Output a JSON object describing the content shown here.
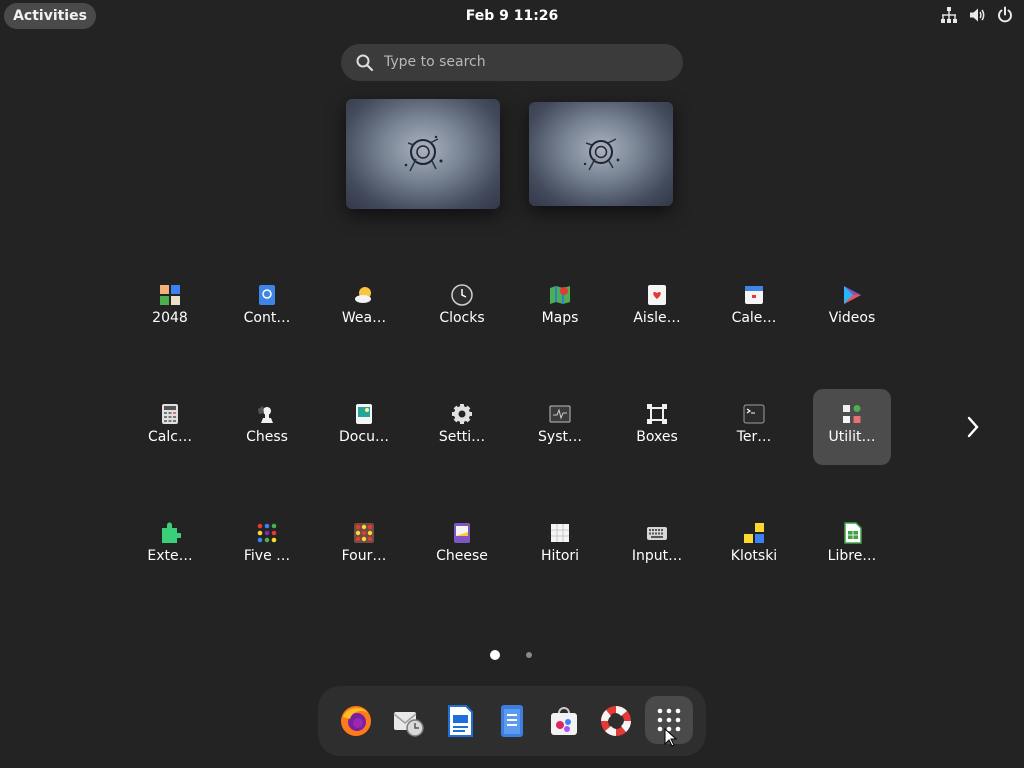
{
  "topbar": {
    "activities_label": "Activities",
    "clock": "Feb 9  11:26",
    "tray_icons": [
      "network-icon",
      "volume-icon",
      "power-icon"
    ]
  },
  "search": {
    "placeholder": "Type to search"
  },
  "workspaces": [
    {
      "name": "workspace-1"
    },
    {
      "name": "workspace-2"
    }
  ],
  "app_grid": {
    "rows": [
      [
        {
          "label": "2048",
          "icon": "2048-icon"
        },
        {
          "label": "Cont…",
          "icon": "contacts-icon"
        },
        {
          "label": "Wea…",
          "icon": "weather-icon"
        },
        {
          "label": "Clocks",
          "icon": "clocks-icon"
        },
        {
          "label": "Maps",
          "icon": "maps-icon"
        },
        {
          "label": "Aisle…",
          "icon": "aisleriot-icon"
        },
        {
          "label": "Cale…",
          "icon": "calendar-icon"
        },
        {
          "label": "Videos",
          "icon": "videos-icon"
        }
      ],
      [
        {
          "label": "Calc…",
          "icon": "calculator-icon"
        },
        {
          "label": "Chess",
          "icon": "chess-icon"
        },
        {
          "label": "Docu…",
          "icon": "document-viewer-icon"
        },
        {
          "label": "Setti…",
          "icon": "settings-icon"
        },
        {
          "label": "Syst…",
          "icon": "system-monitor-icon"
        },
        {
          "label": "Boxes",
          "icon": "boxes-icon"
        },
        {
          "label": "Ter…",
          "icon": "terminal-icon"
        },
        {
          "label": "Utilit…",
          "icon": "utilities-folder-icon",
          "selected": true
        }
      ],
      [
        {
          "label": "Exte…",
          "icon": "extensions-icon"
        },
        {
          "label": "Five …",
          "icon": "five-or-more-icon"
        },
        {
          "label": "Four…",
          "icon": "four-in-a-row-icon"
        },
        {
          "label": "Cheese",
          "icon": "cheese-icon"
        },
        {
          "label": "Hitori",
          "icon": "hitori-icon"
        },
        {
          "label": "Input…",
          "icon": "input-method-icon"
        },
        {
          "label": "Klotski",
          "icon": "klotski-icon"
        },
        {
          "label": "Libre…",
          "icon": "libreoffice-calc-icon"
        }
      ]
    ],
    "page_indicator": {
      "pages": 2,
      "current": 1
    }
  },
  "dash": {
    "items": [
      {
        "icon": "firefox-icon"
      },
      {
        "icon": "evolution-mail-icon"
      },
      {
        "icon": "libreoffice-writer-icon"
      },
      {
        "icon": "text-editor-icon"
      },
      {
        "icon": "software-center-icon"
      },
      {
        "icon": "help-icon"
      },
      {
        "icon": "show-apps-icon"
      }
    ]
  },
  "colors": {
    "background": "#232323",
    "panel": "#2e2e2e",
    "selected": "#4c4c4c",
    "search_bg": "#3b3b3b"
  }
}
